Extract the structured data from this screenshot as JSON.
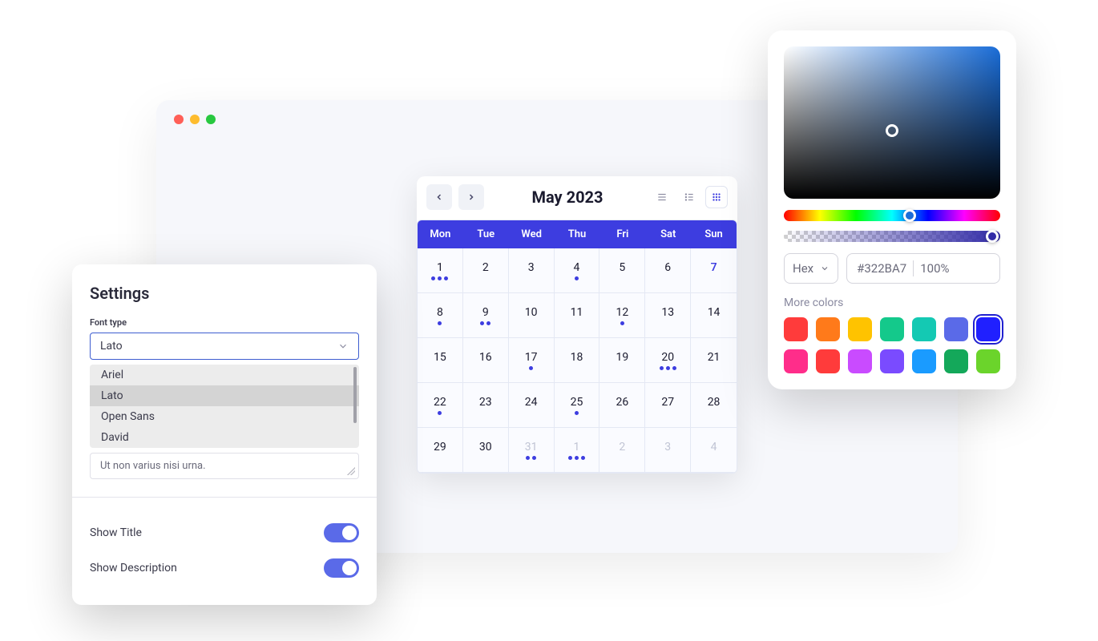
{
  "calendar": {
    "title": "May 2023",
    "dow": [
      "Mon",
      "Tue",
      "Wed",
      "Thu",
      "Fri",
      "Sat",
      "Sun"
    ],
    "days": [
      {
        "n": 1,
        "dots": 3
      },
      {
        "n": 2
      },
      {
        "n": 3
      },
      {
        "n": 4,
        "dots": 1
      },
      {
        "n": 5
      },
      {
        "n": 6
      },
      {
        "n": 7,
        "highlight": true
      },
      {
        "n": 8,
        "dots": 1
      },
      {
        "n": 9,
        "dots": 2
      },
      {
        "n": 10
      },
      {
        "n": 11
      },
      {
        "n": 12,
        "dots": 1
      },
      {
        "n": 13
      },
      {
        "n": 14
      },
      {
        "n": 15
      },
      {
        "n": 16
      },
      {
        "n": 17,
        "dots": 1
      },
      {
        "n": 18
      },
      {
        "n": 19
      },
      {
        "n": 20,
        "dots": 3
      },
      {
        "n": 21
      },
      {
        "n": 22,
        "dots": 1
      },
      {
        "n": 23
      },
      {
        "n": 24
      },
      {
        "n": 25,
        "dots": 1
      },
      {
        "n": 26
      },
      {
        "n": 27
      },
      {
        "n": 28
      },
      {
        "n": 29
      },
      {
        "n": 30
      },
      {
        "n": 31,
        "dots": 2,
        "muted": true
      },
      {
        "n": 1,
        "dots": 3,
        "muted": true
      },
      {
        "n": 2,
        "muted": true
      },
      {
        "n": 3,
        "muted": true
      },
      {
        "n": 4,
        "muted": true
      }
    ]
  },
  "settings": {
    "title": "Settings",
    "font_type_label": "Font type",
    "font_selected": "Lato",
    "font_options": [
      "Ariel",
      "Lato",
      "Open Sans",
      "David"
    ],
    "preview_text": "Ut non varius nisi urna.",
    "show_title_label": "Show Title",
    "show_description_label": "Show Description"
  },
  "color_picker": {
    "format": "Hex",
    "hex_value": "#322BA7",
    "opacity": "100%",
    "more_colors_label": "More colors",
    "swatches": [
      "#ff3b3b",
      "#ff7a1a",
      "#ffc300",
      "#14c98b",
      "#14c9b3",
      "#5a6ae8",
      "#2020ff",
      "#ff2d8a",
      "#ff3b3b",
      "#c94bff",
      "#7a4bff",
      "#1a9bff",
      "#14a85a",
      "#6bd42b"
    ],
    "selected_swatch_index": 6
  }
}
